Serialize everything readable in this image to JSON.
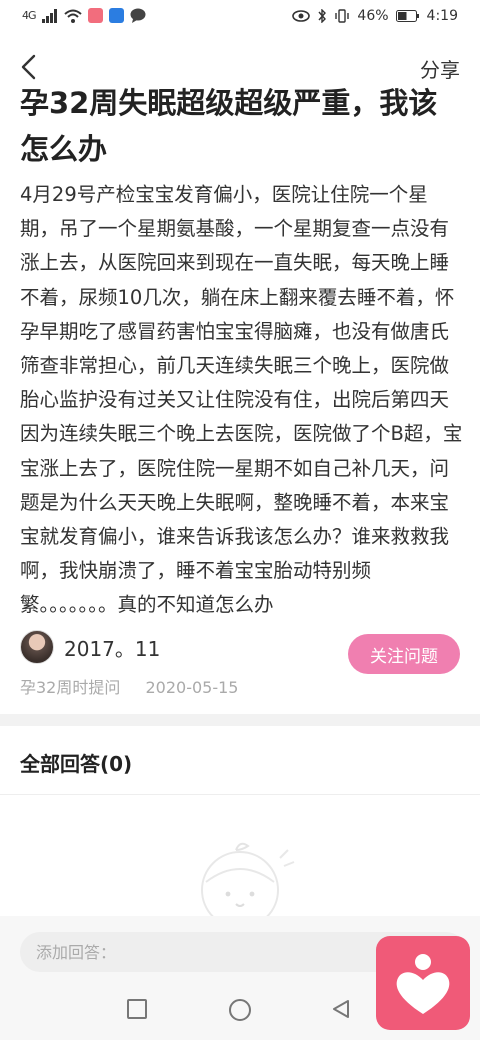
{
  "status_bar": {
    "network": "4G",
    "battery": "46%",
    "time": "4:19"
  },
  "nav": {
    "share_label": "分享"
  },
  "question": {
    "title": "孕32周失眠超级超级严重，我该怎么办",
    "body": "4月29号产检宝宝发育偏小，医院让住院一个星期，吊了一个星期氨基酸，一个星期复查一点没有涨上去，从医院回来到现在一直失眠，每天晚上睡不着，尿频10几次，躺在床上翻来覆去睡不着，怀孕早期吃了感冒药害怕宝宝得脑瘫，也没有做唐氏筛查非常担心，前几天连续失眠三个晚上，医院做胎心监护没有过关又让住院没有住，出院后第四天因为连续失眠三个晚上去医院，医院做了个B超，宝宝涨上去了，医院住院一星期不如自己补几天，问题是为什么天天晚上失眠啊，整晚睡不着，本来宝宝就发育偏小，谁来告诉我该怎么办？谁来救救我啊，我快崩溃了，睡不着宝宝胎动特别频繁。。。。。。。真的不知道怎么办",
    "author": "2017。11",
    "follow_label": "关注问题",
    "stage": "孕32周时提问",
    "date": "2020-05-15"
  },
  "answers": {
    "header": "全部回答(0)"
  },
  "reply": {
    "placeholder": "添加回答："
  },
  "colors": {
    "accent": "#f07fb0",
    "fab": "#f05a78"
  }
}
